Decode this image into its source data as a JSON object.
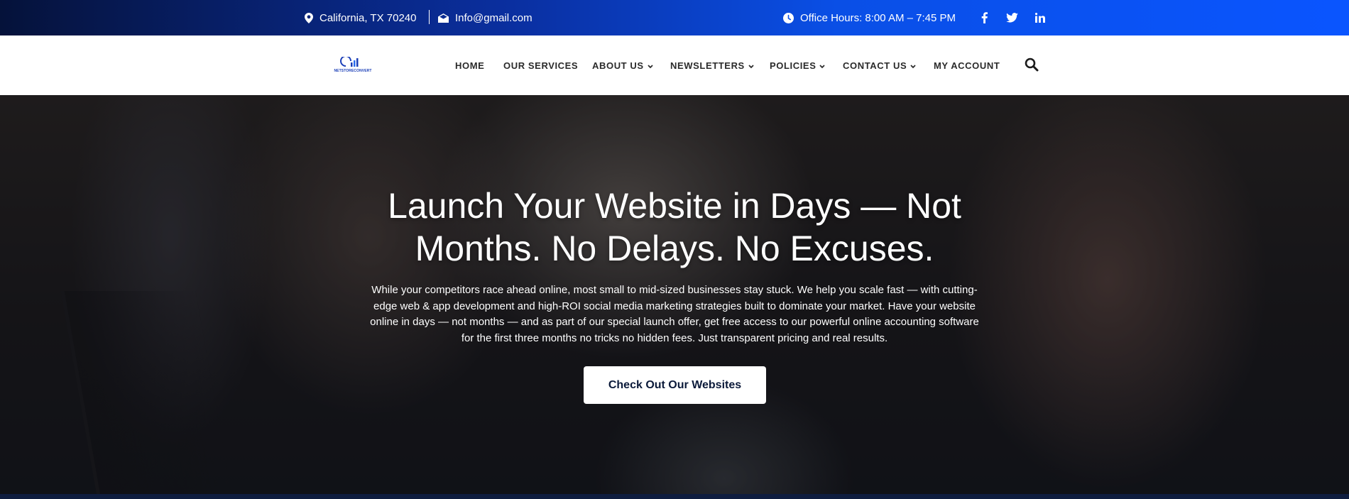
{
  "topbar": {
    "location": "California, TX 70240",
    "email": "Info@gmail.com",
    "office_hours": "Office Hours: 8:00 AM – 7:45 PM",
    "icons": [
      "map-marker-icon",
      "envelope-icon",
      "clock-icon",
      "facebook-icon",
      "twitter-icon",
      "linkedin-icon"
    ]
  },
  "nav": {
    "logo_text": "NETSTORECONVERT",
    "items": [
      {
        "label": "HOME",
        "has_dropdown": false
      },
      {
        "label": "OUR SERVICES",
        "has_dropdown": false
      },
      {
        "label": "ABOUT US",
        "has_dropdown": true
      },
      {
        "label": "NEWSLETTERS",
        "has_dropdown": true
      },
      {
        "label": "POLICIES",
        "has_dropdown": true
      },
      {
        "label": "CONTACT US",
        "has_dropdown": true
      },
      {
        "label": "MY ACCOUNT",
        "has_dropdown": false
      }
    ],
    "search_icon": "search-icon"
  },
  "hero": {
    "title_line1": "Launch Your Website in Days — Not",
    "title_line2": "Months. No Delays. No Excuses.",
    "text_line1": "While your competitors race ahead online, most small to mid-sized businesses stay stuck. We help you scale fast — with cutting-",
    "text_line2": "edge web & app development and high-ROI social media marketing strategies built to dominate your market. Have your website",
    "text_line3": "online in days — not months — and as part of our special launch offer, get free access to our powerful online accounting software",
    "text_line4": "for the first three months no tricks no hidden fees. Just transparent pricing and real results.",
    "cta_label": "Check Out Our Websites"
  },
  "colors": {
    "topbar_start": "#05123a",
    "topbar_end": "#0a55ff",
    "brand_blue": "#1b3fb8",
    "cta_text": "#0b1a3a",
    "bottom_strip": "#0f1d3f"
  }
}
